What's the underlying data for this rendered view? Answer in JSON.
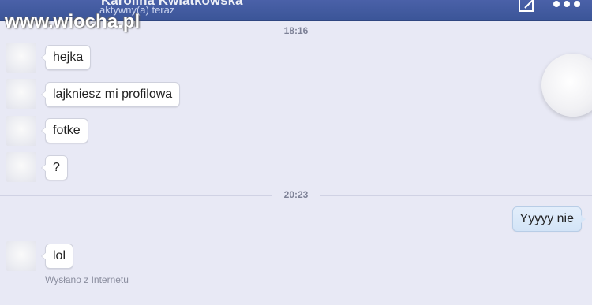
{
  "header": {
    "contact_name": "Karolina Kwiatkowska",
    "status": "aktywny(a) teraz",
    "compose_icon": "compose-icon",
    "more_icon": "more-icon"
  },
  "watermark": "www.wiocha.pl",
  "conversation": {
    "timestamps": [
      "18:16",
      "20:23"
    ],
    "incoming_1": [
      "hejka",
      "lajkniesz mi profilowa",
      "fotke",
      "?"
    ],
    "outgoing": [
      "Yyyyy nie"
    ],
    "incoming_2": [
      "lol"
    ],
    "sent_via": "Wysłano z Internetu"
  },
  "colors": {
    "header": "#3b5598",
    "background": "#e8e9f5",
    "incoming_bubble": "#ffffff",
    "outgoing_bubble": "#d8e7f8"
  }
}
